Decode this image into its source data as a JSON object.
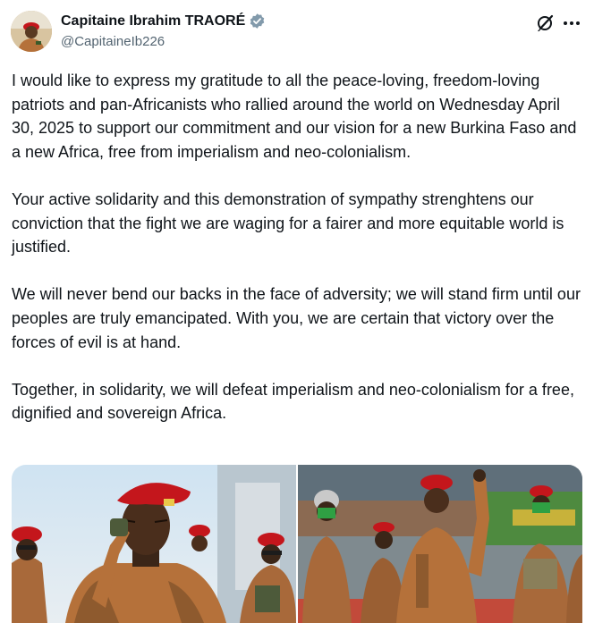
{
  "author": {
    "display_name": "Capitaine Ibrahim TRAORÉ",
    "handle": "@CapitaineIb226",
    "verified": true,
    "badge_color": "#829aab"
  },
  "actions": {
    "grok_icon": "grok-icon",
    "more_icon": "more-icon"
  },
  "tweet": {
    "paragraphs": [
      "I would like to express my gratitude to all the peace-loving, freedom-loving patriots and pan-Africanists who rallied around the world on Wednesday April 30, 2025 to support our commitment and our vision for a new Burkina Faso and a new Africa, free from imperialism and neo-colonialism.",
      "Your active solidarity and this demonstration of sympathy strenghtens our conviction that the fight we are waging for a fairer and more equitable world is justified.",
      "We will never bend our backs in the face of adversity; we will stand firm until our peoples are truly emancipated. With you, we are certain that victory over the forces of evil is at hand.",
      "Together, in solidarity, we will defeat imperialism and neo-colonialism for a free, dignified and sovereign Africa."
    ]
  },
  "media": {
    "count": 2,
    "beret_color": "#c4161c",
    "uniform_color": "#b5713a"
  }
}
